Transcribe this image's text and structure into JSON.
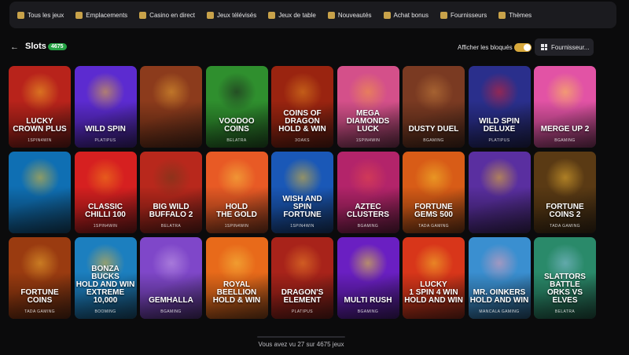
{
  "nav": {
    "items": [
      {
        "label": "Tous les jeux",
        "icon": "cards-icon"
      },
      {
        "label": "Emplacements",
        "icon": "slot-icon"
      },
      {
        "label": "Casino en direct",
        "icon": "dealer-icon"
      },
      {
        "label": "Jeux télévisés",
        "icon": "tv-icon"
      },
      {
        "label": "Jeux de table",
        "icon": "table-icon"
      },
      {
        "label": "Nouveautés",
        "icon": "new-icon"
      },
      {
        "label": "Achat bonus",
        "icon": "bonus-icon"
      },
      {
        "label": "Fournisseurs",
        "icon": "provider-icon"
      },
      {
        "label": "Thèmes",
        "icon": "themes-icon"
      }
    ]
  },
  "header": {
    "back_icon": "←",
    "title": "Slots",
    "count": "4675",
    "toggle_label": "Afficher les bloqués",
    "provider_button": "Fournisseur..."
  },
  "games": [
    {
      "name": "LUCKY\nCROWN PLUS",
      "provider": "1SPIN4WIN",
      "color": "#b8231b",
      "accent": "#f4b126"
    },
    {
      "name": "WILD SPIN",
      "provider": "PLATIPUS",
      "color": "#5c2bd0",
      "accent": "#f3c028"
    },
    {
      "name": "",
      "provider": "",
      "color": "#8c3b1c",
      "accent": "#e8a533"
    },
    {
      "name": "VOODOO\nCOINS",
      "provider": "BELATRA",
      "color": "#2f8f2e",
      "accent": "#1b1b1b"
    },
    {
      "name": "COINS OF\nDRAGON\nHOLD & WIN",
      "provider": "3OAKS",
      "color": "#9a2410",
      "accent": "#e38b1f"
    },
    {
      "name": "MEGA\nDIAMONDS\nLUCK",
      "provider": "1SPIN4WIN",
      "color": "#d4508a",
      "accent": "#f6a13a"
    },
    {
      "name": "DUSTY DUEL",
      "provider": "BGAMING",
      "color": "#7a3a22",
      "accent": "#c8823e"
    },
    {
      "name": "WILD SPIN\nDELUXE",
      "provider": "PLATIPUS",
      "color": "#2a2f8c",
      "accent": "#e2212a"
    },
    {
      "name": "MERGE UP 2",
      "provider": "BGAMING",
      "color": "#e253a5",
      "accent": "#ffd14c"
    },
    {
      "name": "",
      "provider": "",
      "color": "#0f6fb3",
      "accent": "#f3c028"
    },
    {
      "name": "CLASSIC\nCHILLI 100",
      "provider": "1SPIN4WIN",
      "color": "#d62020",
      "accent": "#f48a1a"
    },
    {
      "name": "BIG WILD\nBUFFALO 2",
      "provider": "BELATRA",
      "color": "#b8281c",
      "accent": "#6b3a1a"
    },
    {
      "name": "HOLD\nTHE GOLD",
      "provider": "1SPIN4WIN",
      "color": "#e85a25",
      "accent": "#f7c542"
    },
    {
      "name": "WISH AND SPIN\nFORTUNE",
      "provider": "1SPIN4WIN",
      "color": "#1a58b7",
      "accent": "#f3c028"
    },
    {
      "name": "AZTEC\nCLUSTERS",
      "provider": "BGAMING",
      "color": "#b3246a",
      "accent": "#e84a4a"
    },
    {
      "name": "FORTUNE\nGEMS 500",
      "provider": "TADA GAMING",
      "color": "#d85c17",
      "accent": "#f6c42e"
    },
    {
      "name": "",
      "provider": "",
      "color": "#5a2fa0",
      "accent": "#f3c028"
    },
    {
      "name": "FORTUNE\nCOINS 2",
      "provider": "TADA GAMING",
      "color": "#5a3a14",
      "accent": "#f2b833"
    },
    {
      "name": "FORTUNE\nCOINS",
      "provider": "TADA GAMING",
      "color": "#9a3b10",
      "accent": "#f0b032"
    },
    {
      "name": "BONZA\nBUCKS\nHOLD AND WIN\nEXTREME 10,000",
      "provider": "BOOMING",
      "color": "#1c7fbf",
      "accent": "#f2b833"
    },
    {
      "name": "GEMHALLA",
      "provider": "BGAMING",
      "color": "#7f47c9",
      "accent": "#c8a3e8"
    },
    {
      "name": "ROYAL\nBEELLION\nHOLD & WIN",
      "provider": "",
      "color": "#e86a1a",
      "accent": "#f7c542"
    },
    {
      "name": "DRAGON'S\nELEMENT",
      "provider": "PLATIPUS",
      "color": "#a8231a",
      "accent": "#f08a2a"
    },
    {
      "name": "MULTI RUSH",
      "provider": "BGAMING",
      "color": "#6a1fc2",
      "accent": "#f3e22a"
    },
    {
      "name": "LUCKY\n1 SPIN 4 WIN\nHOLD AND WIN",
      "provider": "",
      "color": "#d8361a",
      "accent": "#f6c42e"
    },
    {
      "name": "MR. OINKERS\nHOLD AND WIN",
      "provider": "MANCALA GAMING",
      "color": "#3a8fd0",
      "accent": "#f3a0b6"
    },
    {
      "name": "SLATTORS\nBATTLE\nORKS VS ELVES",
      "provider": "BELATRA",
      "color": "#2a8a6a",
      "accent": "#8fc3e0"
    }
  ],
  "footer": {
    "status": "Vous avez vu 27 sur 4675 jeux"
  }
}
